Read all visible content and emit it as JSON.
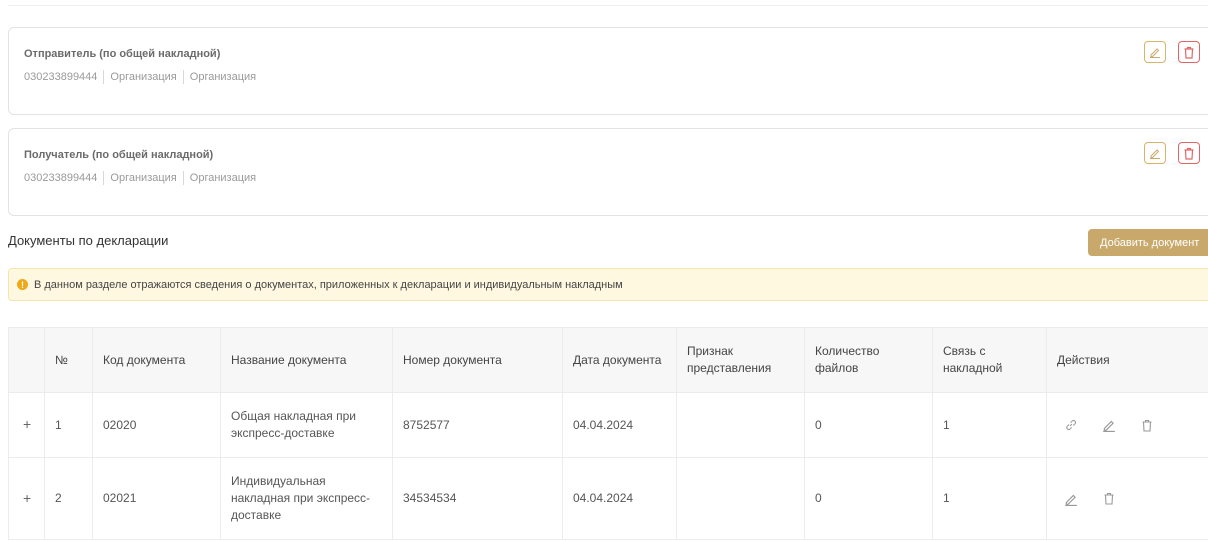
{
  "sender": {
    "title": "Отправитель (по общей накладной)",
    "inn": "030233899444",
    "type": "Организация",
    "name": "Организация"
  },
  "receiver": {
    "title": "Получатель (по общей накладной)",
    "inn": "030233899444",
    "type": "Организация",
    "name": "Организация"
  },
  "documents": {
    "section_title": "Документы по декларации",
    "add_button": "Добавить документ",
    "info_text": "В данном разделе отражаются сведения о документах, приложенных к декларации и индивидуальным накладным",
    "columns": {
      "num": "№",
      "code": "Код документа",
      "name": "Название документа",
      "number": "Номер документа",
      "date": "Дата документа",
      "sign": "Признак представления",
      "files": "Количество файлов",
      "link": "Связь с накладной",
      "actions": "Действия"
    },
    "rows": [
      {
        "expand": "+",
        "num": "1",
        "code": "02020",
        "name": "Общая накладная при экспресс-доставке",
        "number": "8752577",
        "date": "04.04.2024",
        "sign": "",
        "files": "0",
        "link": "1"
      },
      {
        "expand": "+",
        "num": "2",
        "code": "02021",
        "name": "Индивидуальная накладная при экспресс-доставке",
        "number": "34534534",
        "date": "04.04.2024",
        "sign": "",
        "files": "0",
        "link": "1"
      }
    ]
  },
  "icons": {
    "edit": "pencil-icon",
    "delete": "trash-icon",
    "link": "link-icon",
    "info": "info-icon"
  },
  "colors": {
    "accent": "#c8a96b",
    "edit_border": "#d9b36b",
    "delete_border": "#e06666",
    "info_background": "#fff8e1",
    "info_icon": "#f0a818"
  }
}
